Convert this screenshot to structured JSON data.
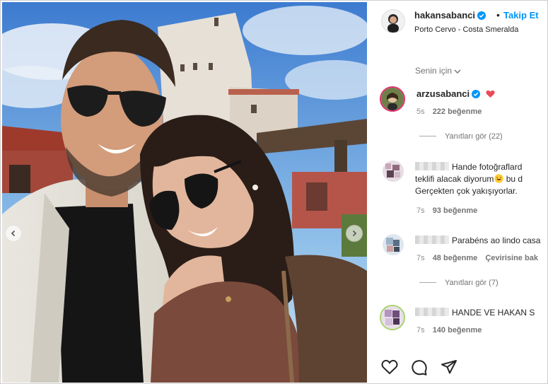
{
  "post": {
    "username": "hakansabanci",
    "separator": "•",
    "follow_label": "Takip Et",
    "location": "Porto Cervo - Costa Smeralda"
  },
  "sort": {
    "label": "Senin için"
  },
  "comments": [
    {
      "username": "arzusabanci",
      "has_heart_emoji": true,
      "time": "5s",
      "likes": "222 beğenme",
      "replies_label": "Yanıtları gör (22)"
    },
    {
      "username_obscured": true,
      "text_line1": "Hande fotoğraflard",
      "text_line2_a": "teklifi alacak diyorum",
      "text_line2_b": " bu d",
      "text_line3": "Gerçekten çok yakışıyorlar.",
      "time": "7s",
      "likes": "93 beğenme"
    },
    {
      "username_obscured": true,
      "text": "Parabéns ao lindo casa",
      "time": "7s",
      "likes": "48 beğenme",
      "translate_label": "Çevirisine bak",
      "replies_label": "Yanıtları gör (7)"
    },
    {
      "username_obscured": true,
      "text": "HANDE VE HAKAN S",
      "time": "7s",
      "likes": "140 beğenme"
    }
  ],
  "actions": {
    "icons": [
      "heart-icon",
      "comment-icon",
      "share-icon"
    ]
  },
  "colors": {
    "link": "#0095f6",
    "verified": "#0095f6",
    "heart": "#ed4956",
    "meta": "#8e8e8e"
  }
}
